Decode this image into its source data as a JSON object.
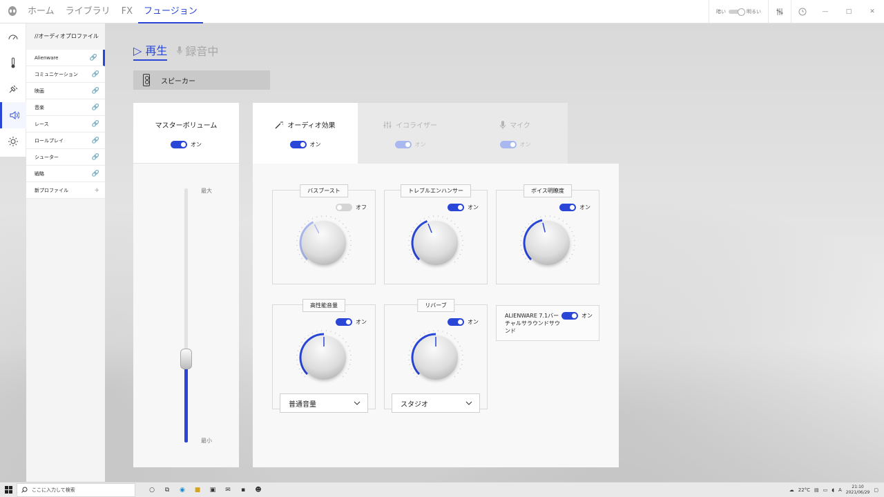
{
  "topbar": {
    "tabs": [
      {
        "label": "ホーム",
        "active": false
      },
      {
        "label": "ライブラリ",
        "active": false
      },
      {
        "label": "FX",
        "active": false
      },
      {
        "label": "フュージョン",
        "active": true
      }
    ],
    "brightness_dark": "暗い",
    "brightness_light": "明るい",
    "window_controls": [
      "—",
      "□",
      "✕"
    ]
  },
  "rail": {
    "items": [
      {
        "icon": "gauge-icon",
        "active": false
      },
      {
        "icon": "thermometer-icon",
        "active": false
      },
      {
        "icon": "power-plug-icon",
        "active": false
      },
      {
        "icon": "speaker-icon",
        "active": true
      },
      {
        "icon": "sun-icon",
        "active": false
      }
    ]
  },
  "profiles": {
    "title": "//オーディオプロファイル",
    "items": [
      {
        "label": "Alienware",
        "active": true
      },
      {
        "label": "コミュニケーション",
        "active": false
      },
      {
        "label": "映画",
        "active": false
      },
      {
        "label": "音楽",
        "active": false
      },
      {
        "label": "レース",
        "active": false
      },
      {
        "label": "ロールプレイ",
        "active": false
      },
      {
        "label": "シューター",
        "active": false
      },
      {
        "label": "戦略",
        "active": false
      }
    ],
    "new_profile": "新プロファイル"
  },
  "playback": {
    "play_tab": "▷ 再生",
    "record_tab": "録音中",
    "device": "スピーカー"
  },
  "master_volume": {
    "title": "マスターボリューム",
    "toggle_state": "オン",
    "max_label": "最大",
    "min_label": "最小",
    "level": 0.33
  },
  "fx_tabs": [
    {
      "label": "オーディオ効果",
      "state": "オン",
      "active": true,
      "icon": "magic-wand-icon"
    },
    {
      "label": "イコライザー",
      "state": "オン",
      "active": false,
      "icon": "equalizer-icon"
    },
    {
      "label": "マイク",
      "state": "オン",
      "active": false,
      "icon": "microphone-icon"
    }
  ],
  "effects": {
    "bass_boost": {
      "label": "バスブースト",
      "state": "オフ",
      "on": false,
      "level": 0.4
    },
    "treble_enhancer": {
      "label": "トレブルエンハンサー",
      "state": "オン",
      "on": true,
      "level": 0.42
    },
    "voice_clarity": {
      "label": "ボイス明瞭度",
      "state": "オン",
      "on": true,
      "level": 0.45
    },
    "high_performance_volume": {
      "label": "高性能音量",
      "state": "オン",
      "on": true,
      "level": 0.5,
      "dropdown": "普通音量"
    },
    "reverb": {
      "label": "リバーブ",
      "state": "オン",
      "on": true,
      "level": 0.5,
      "dropdown": "スタジオ"
    },
    "surround": {
      "label": "ALIENWARE 7.1バーチャルサラウンドサウンド",
      "state": "オン",
      "on": true
    }
  },
  "taskbar": {
    "search_placeholder": "ここに入力して検索",
    "temperature": "22°C",
    "lang": "A",
    "time": "21:10",
    "date": "2021/06/29"
  },
  "colors": {
    "accent": "#2946d6",
    "accent_dim": "#a9b8ee"
  }
}
